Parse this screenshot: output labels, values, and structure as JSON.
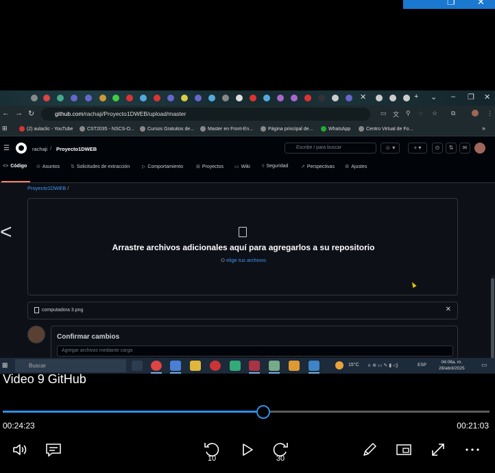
{
  "window_controls": {
    "restore": "❐",
    "close": "✕"
  },
  "browser": {
    "url_host": "github.com",
    "url_path": "/rachaji/Proyecto1DWEB/upload/master",
    "bookmarks": [
      "(2) aulaclic - YouTube",
      "CST2035 - NSCS-O...",
      "Cursos Gratuitos de...",
      "Master en Front-En...",
      "Página principal de...",
      "WhatsApp",
      "Centro Virtual de Fo..."
    ]
  },
  "github": {
    "owner": "rachaji",
    "separator": "/",
    "repo": "Proyecto1DWEB",
    "search_placeholder": "Escribe / para buscar",
    "nav": [
      "Código",
      "Asuntos",
      "Solicitudes de extracción",
      "Comportamiento",
      "Proyectos",
      "Wiki",
      "Seguridad",
      "Perspectivas",
      "Ajustes"
    ],
    "breadcrumb_repo": "Proyecto1DWEB",
    "breadcrumb_sep": "/",
    "drop_title": "Arrastre archivos adicionales aquí para agregarlos a su repositorio",
    "drop_prefix": "O ",
    "drop_link": "elige tus archivos",
    "file_name": "computadora 3.png",
    "commit_title": "Confirmar cambios",
    "commit_placeholder": "Agregar archivos mediante carga"
  },
  "taskbar": {
    "search_placeholder": "Buscar",
    "temperature": "15°C",
    "language": "ESP",
    "time": "04:08a. m.",
    "date": "28/abril/2025"
  },
  "player": {
    "title": "Video 9  GitHub",
    "elapsed": "00:24:23",
    "remaining": "00:21:03",
    "progress": 0.535,
    "skip_back_label": "10",
    "skip_forward_label": "30"
  },
  "colors": {
    "accent": "#2f8fe8",
    "github_link": "#4493f8",
    "github_bg": "#0d1117"
  }
}
